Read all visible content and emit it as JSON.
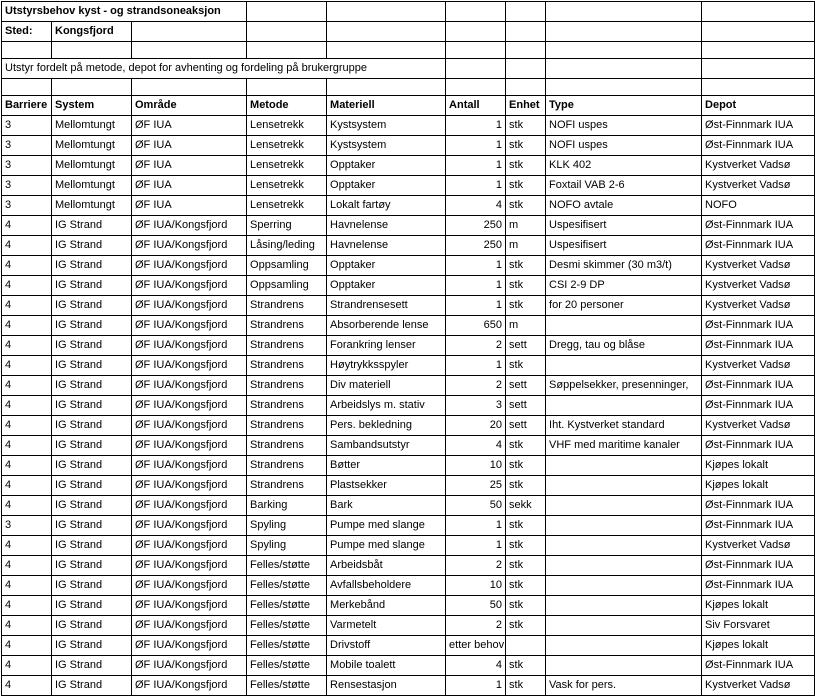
{
  "title": "Utstyrsbehov kyst - og strandsoneaksjon",
  "sted_label": "Sted:",
  "sted_value": "Kongsfjord",
  "subtitle": "Utstyr fordelt på metode, depot for avhenting og fordeling på brukergruppe",
  "headers": [
    "Barriere",
    "System",
    "Område",
    "Metode",
    "Materiell",
    "Antall",
    "Enhet",
    "Type",
    "Depot"
  ],
  "rows": [
    [
      "3",
      "Mellomtungt",
      "ØF IUA",
      "Lensetrekk",
      "Kystsystem",
      "1",
      "stk",
      "NOFI uspes",
      "Øst-Finnmark IUA"
    ],
    [
      "3",
      "Mellomtungt",
      "ØF IUA",
      "Lensetrekk",
      "Kystsystem",
      "1",
      "stk",
      "NOFI uspes",
      "Øst-Finnmark IUA"
    ],
    [
      "3",
      "Mellomtungt",
      "ØF IUA",
      "Lensetrekk",
      "Opptaker",
      "1",
      "stk",
      "KLK 402",
      "Kystverket Vadsø"
    ],
    [
      "3",
      "Mellomtungt",
      "ØF IUA",
      "Lensetrekk",
      "Opptaker",
      "1",
      "stk",
      "Foxtail VAB 2-6",
      "Kystverket Vadsø"
    ],
    [
      "3",
      "Mellomtungt",
      "ØF IUA",
      "Lensetrekk",
      "Lokalt fartøy",
      "4",
      "stk",
      "NOFO avtale",
      "NOFO"
    ],
    [
      "4",
      "IG Strand",
      "ØF IUA/Kongsfjord",
      "Sperring",
      "Havnelense",
      "250",
      "m",
      "Uspesifisert",
      "Øst-Finnmark IUA"
    ],
    [
      "4",
      "IG Strand",
      "ØF IUA/Kongsfjord",
      "Låsing/leding",
      "Havnelense",
      "250",
      "m",
      "Uspesifisert",
      "Øst-Finnmark IUA"
    ],
    [
      "4",
      "IG Strand",
      "ØF IUA/Kongsfjord",
      "Oppsamling",
      "Opptaker",
      "1",
      "stk",
      "Desmi skimmer (30 m3/t)",
      "Kystverket Vadsø"
    ],
    [
      "4",
      "IG Strand",
      "ØF IUA/Kongsfjord",
      "Oppsamling",
      "Opptaker",
      "1",
      "stk",
      "CSI 2-9 DP",
      "Kystverket Vadsø"
    ],
    [
      "4",
      "IG Strand",
      "ØF IUA/Kongsfjord",
      "Strandrens",
      "Strandrensesett",
      "1",
      "stk",
      "for 20 personer",
      "Kystverket Vadsø"
    ],
    [
      "4",
      "IG Strand",
      "ØF IUA/Kongsfjord",
      "Strandrens",
      "Absorberende lense",
      "650",
      "m",
      "",
      "Øst-Finnmark IUA"
    ],
    [
      "4",
      "IG Strand",
      "ØF IUA/Kongsfjord",
      "Strandrens",
      "Forankring lenser",
      "2",
      "sett",
      "Dregg, tau og blåse",
      "Øst-Finnmark IUA"
    ],
    [
      "4",
      "IG Strand",
      "ØF IUA/Kongsfjord",
      "Strandrens",
      "Høytrykksspyler",
      "1",
      "stk",
      "",
      "Kystverket Vadsø"
    ],
    [
      "4",
      "IG Strand",
      "ØF IUA/Kongsfjord",
      "Strandrens",
      "Div materiell",
      "2",
      "sett",
      "Søppelsekker, presenninger,",
      "Øst-Finnmark IUA"
    ],
    [
      "4",
      "IG Strand",
      "ØF IUA/Kongsfjord",
      "Strandrens",
      "Arbeidslys m. stativ",
      "3",
      "sett",
      "",
      "Øst-Finnmark IUA"
    ],
    [
      "4",
      "IG Strand",
      "ØF IUA/Kongsfjord",
      "Strandrens",
      "Pers. bekledning",
      "20",
      "sett",
      "Iht. Kystverket standard",
      "Kystverket Vadsø"
    ],
    [
      "4",
      "IG Strand",
      "ØF IUA/Kongsfjord",
      "Strandrens",
      "Sambandsutstyr",
      "4",
      "stk",
      "VHF med maritime kanaler",
      "Øst-Finnmark IUA"
    ],
    [
      "4",
      "IG Strand",
      "ØF IUA/Kongsfjord",
      "Strandrens",
      "Bøtter",
      "10",
      "stk",
      "",
      "Kjøpes lokalt"
    ],
    [
      "4",
      "IG Strand",
      "ØF IUA/Kongsfjord",
      "Strandrens",
      "Plastsekker",
      "25",
      "stk",
      "",
      "Kjøpes lokalt"
    ],
    [
      "4",
      "IG Strand",
      "ØF IUA/Kongsfjord",
      "Barking",
      "Bark",
      "50",
      "sekk",
      "",
      "Øst-Finnmark IUA"
    ],
    [
      "3",
      "IG Strand",
      "ØF IUA/Kongsfjord",
      "Spyling",
      "Pumpe med slange",
      "1",
      "stk",
      "",
      "Øst-Finnmark IUA"
    ],
    [
      "4",
      "IG Strand",
      "ØF IUA/Kongsfjord",
      "Spyling",
      "Pumpe med slange",
      "1",
      "stk",
      "",
      "Kystverket Vadsø"
    ],
    [
      "4",
      "IG Strand",
      "ØF IUA/Kongsfjord",
      "Felles/støtte",
      "Arbeidsbåt",
      "2",
      "stk",
      "",
      "Øst-Finnmark IUA"
    ],
    [
      "4",
      "IG Strand",
      "ØF IUA/Kongsfjord",
      "Felles/støtte",
      "Avfallsbeholdere",
      "10",
      "stk",
      "",
      "Øst-Finnmark IUA"
    ],
    [
      "4",
      "IG Strand",
      "ØF IUA/Kongsfjord",
      "Felles/støtte",
      "Merkebånd",
      "50",
      "stk",
      "",
      "Kjøpes lokalt"
    ],
    [
      "4",
      "IG Strand",
      "ØF IUA/Kongsfjord",
      "Felles/støtte",
      "Varmetelt",
      "2",
      "stk",
      "",
      "Siv Forsvaret"
    ],
    [
      "4",
      "IG Strand",
      "ØF IUA/Kongsfjord",
      "Felles/støtte",
      "Drivstoff",
      "etter behov",
      "",
      "",
      "Kjøpes lokalt"
    ],
    [
      "4",
      "IG Strand",
      "ØF IUA/Kongsfjord",
      "Felles/støtte",
      "Mobile toalett",
      "4",
      "stk",
      "",
      "Øst-Finnmark IUA"
    ],
    [
      "4",
      "IG Strand",
      "ØF IUA/Kongsfjord",
      "Felles/støtte",
      "Rensestasjon",
      "1",
      "stk",
      "Vask for pers.",
      "Kystverket Vadsø"
    ]
  ]
}
